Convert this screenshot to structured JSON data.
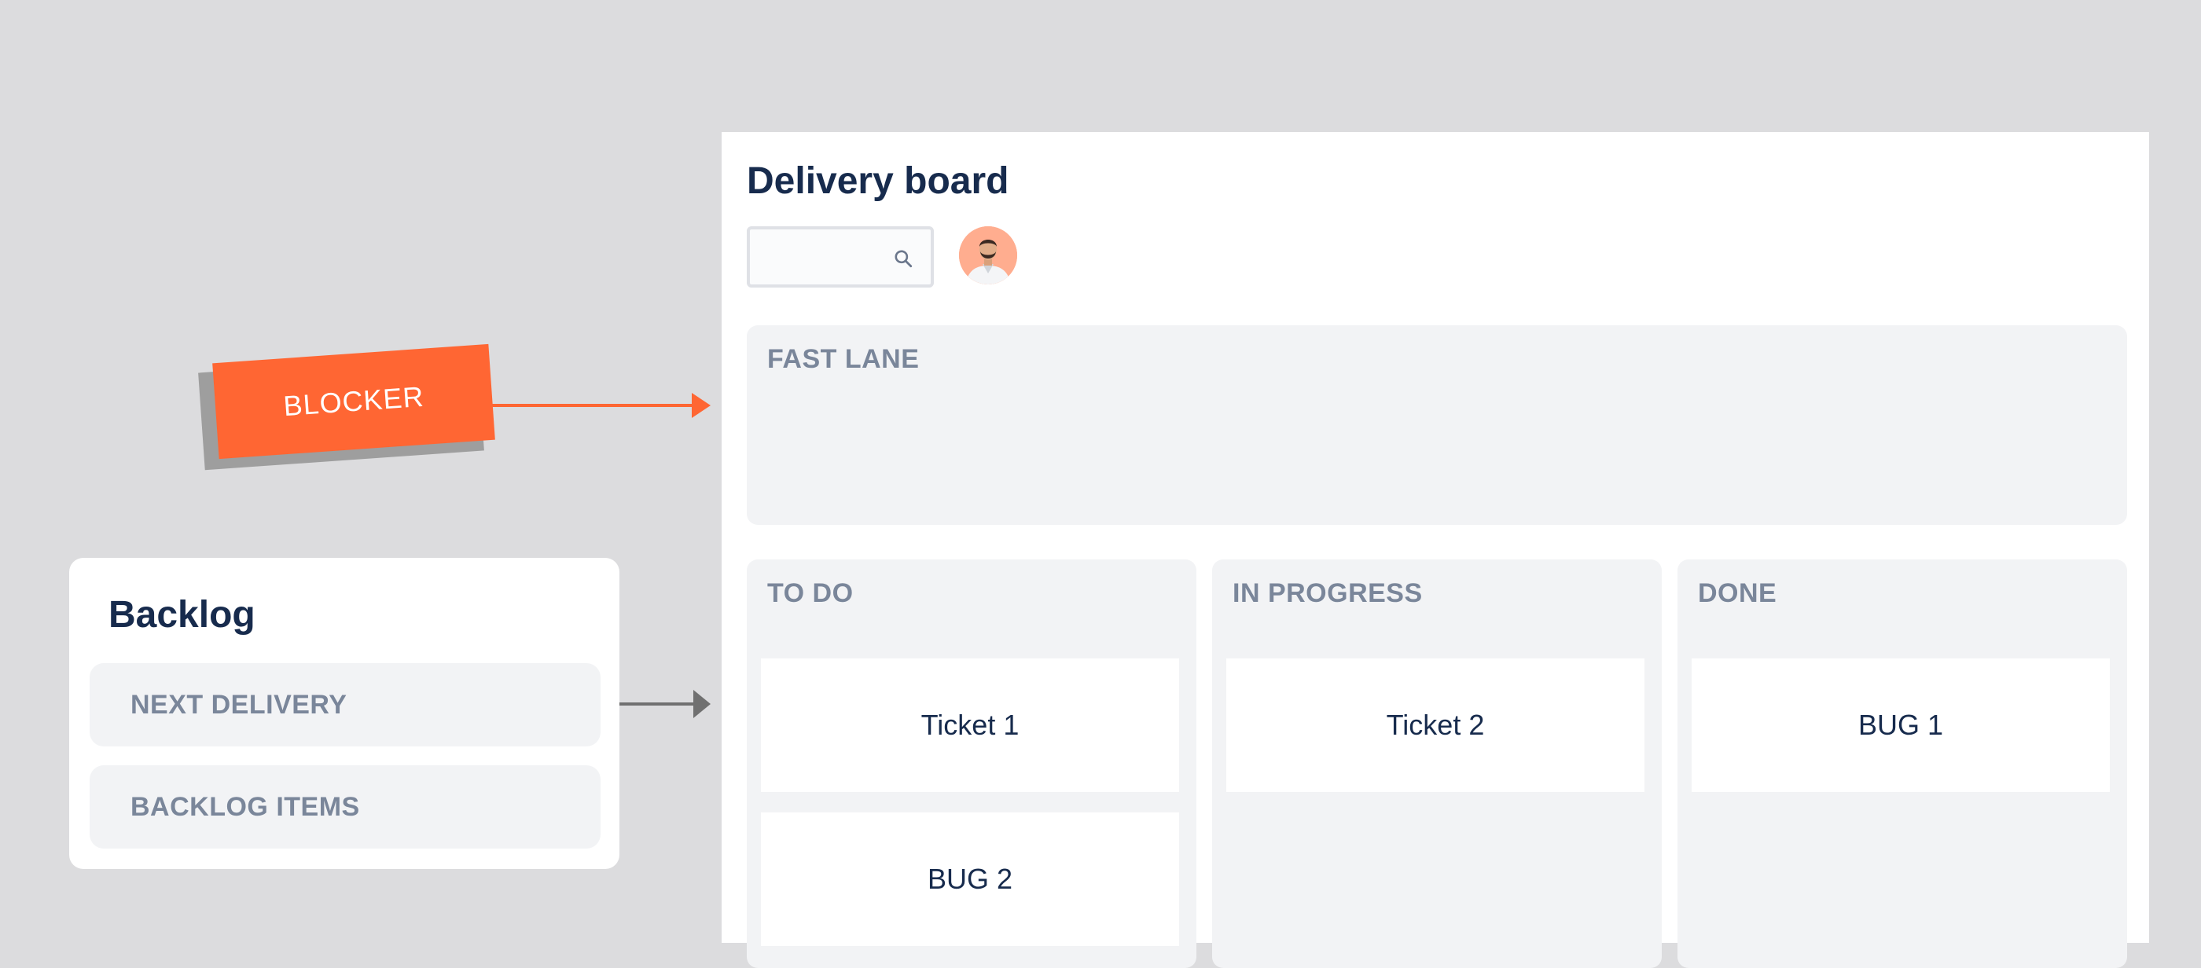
{
  "board": {
    "title": "Delivery board",
    "search_placeholder": "",
    "avatar_alt": "User avatar",
    "fast_lane": {
      "title": "FAST LANE"
    },
    "columns": [
      {
        "title": "TO DO",
        "cards": [
          "Ticket 1",
          "BUG 2"
        ]
      },
      {
        "title": "IN PROGRESS",
        "cards": [
          "Ticket 2"
        ]
      },
      {
        "title": "DONE",
        "cards": [
          "BUG 1"
        ]
      }
    ]
  },
  "backlog": {
    "title": "Backlog",
    "items": [
      "NEXT DELIVERY",
      "BACKLOG ITEMS"
    ]
  },
  "blocker": {
    "label": "BLOCKER"
  },
  "colors": {
    "background": "#dcdcde",
    "accent": "#ff6633",
    "lane": "#f2f3f5",
    "heading": "#172b4d",
    "muted": "#7a869a"
  },
  "icons": {
    "search": "search-icon",
    "arrow": "arrow-right-icon"
  }
}
